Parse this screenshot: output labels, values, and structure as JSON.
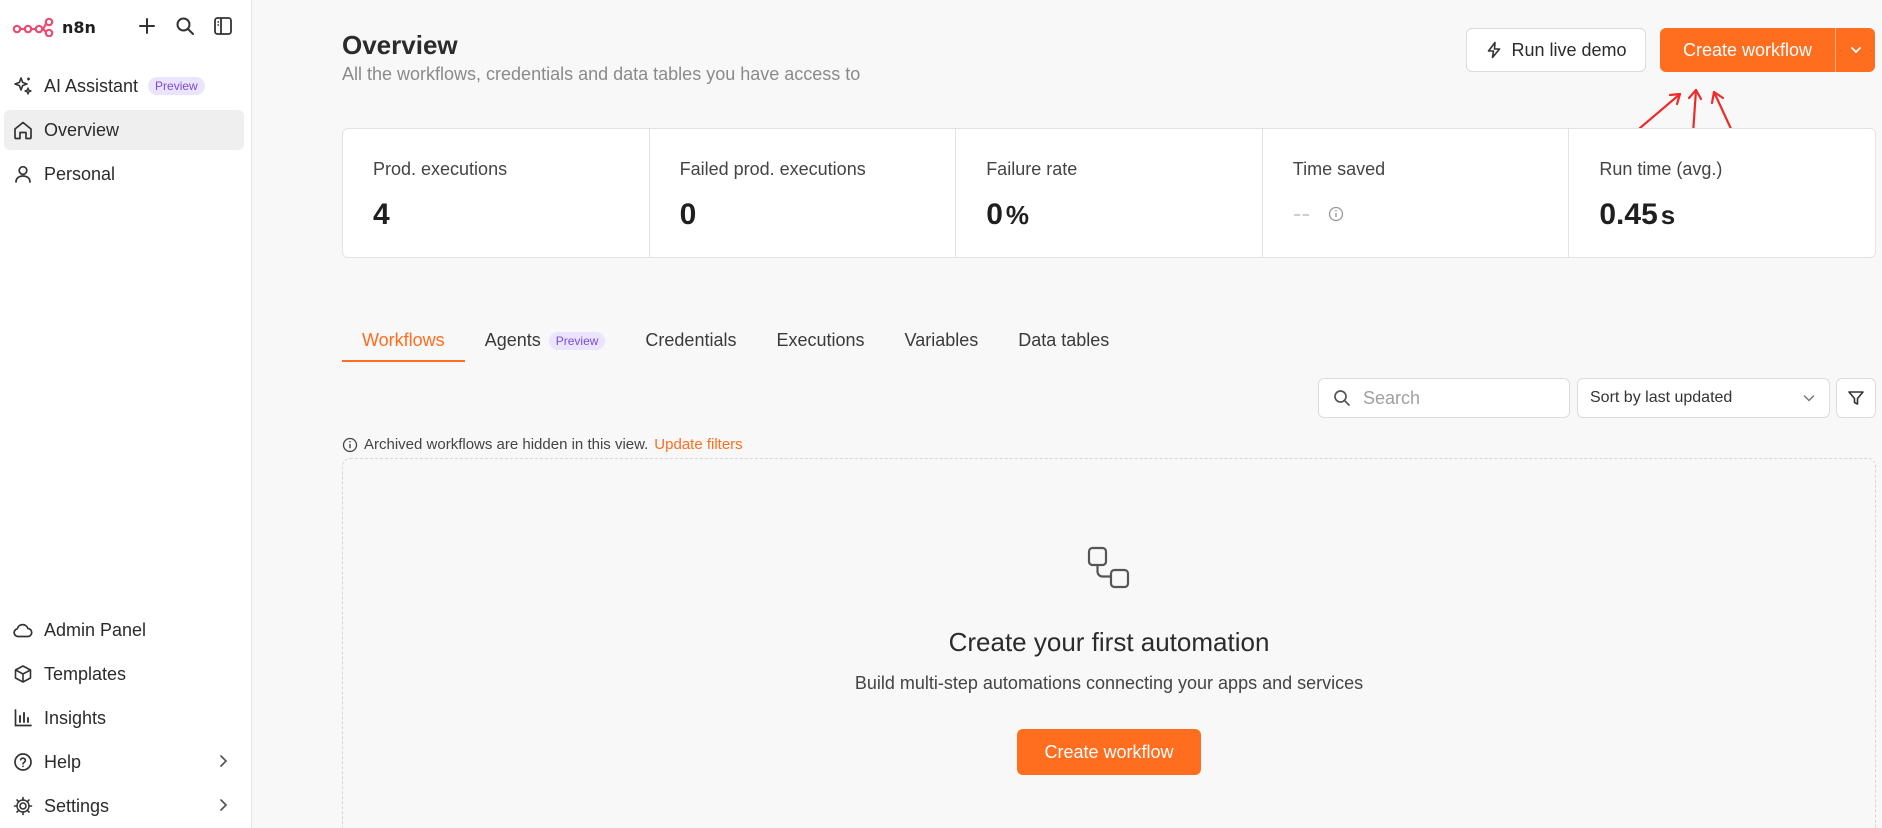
{
  "sidebar": {
    "brand": "n8n",
    "top_icons": [
      "plus-icon",
      "search-icon",
      "panel-toggle-icon"
    ],
    "nav_top": [
      {
        "label": "AI Assistant",
        "badge": "Preview",
        "icon": "sparkles-icon"
      },
      {
        "label": "Overview",
        "icon": "home-icon",
        "active": true
      },
      {
        "label": "Personal",
        "icon": "user-icon"
      }
    ],
    "nav_bottom": [
      {
        "label": "Admin Panel",
        "icon": "cloud-icon"
      },
      {
        "label": "Templates",
        "icon": "box-icon"
      },
      {
        "label": "Insights",
        "icon": "bar-chart-icon"
      },
      {
        "label": "Help",
        "icon": "help-icon",
        "has_submenu": true
      },
      {
        "label": "Settings",
        "icon": "gear-icon",
        "has_submenu": true
      }
    ]
  },
  "header": {
    "title": "Overview",
    "subtitle": "All the workflows, credentials and data tables you have access to",
    "demo_button": "Run live demo",
    "create_button": "Create workflow"
  },
  "stats": [
    {
      "label": "Prod. executions",
      "value": "4",
      "unit": ""
    },
    {
      "label": "Failed prod. executions",
      "value": "0",
      "unit": ""
    },
    {
      "label": "Failure rate",
      "value": "0",
      "unit": "%"
    },
    {
      "label": "Time saved",
      "value": "--",
      "unit": ""
    },
    {
      "label": "Run time (avg.)",
      "value": "0.45",
      "unit": "s"
    }
  ],
  "tabs": [
    {
      "label": "Workflows",
      "active": true
    },
    {
      "label": "Agents",
      "badge": "Preview"
    },
    {
      "label": "Credentials"
    },
    {
      "label": "Executions"
    },
    {
      "label": "Variables"
    },
    {
      "label": "Data tables"
    }
  ],
  "toolbar": {
    "search_placeholder": "Search",
    "sort_label": "Sort by last updated"
  },
  "notice": {
    "text": "Archived workflows are hidden in this view.",
    "link": "Update filters"
  },
  "empty_state": {
    "title": "Create your first automation",
    "subtitle": "Build multi-step automations connecting your apps and services",
    "button": "Create workflow"
  },
  "colors": {
    "accent": "#ff6d1f",
    "annotation_arrow": "#ee2b2b",
    "preview_badge_bg": "#ebe4ff",
    "preview_badge_text": "#7a4bd6"
  }
}
